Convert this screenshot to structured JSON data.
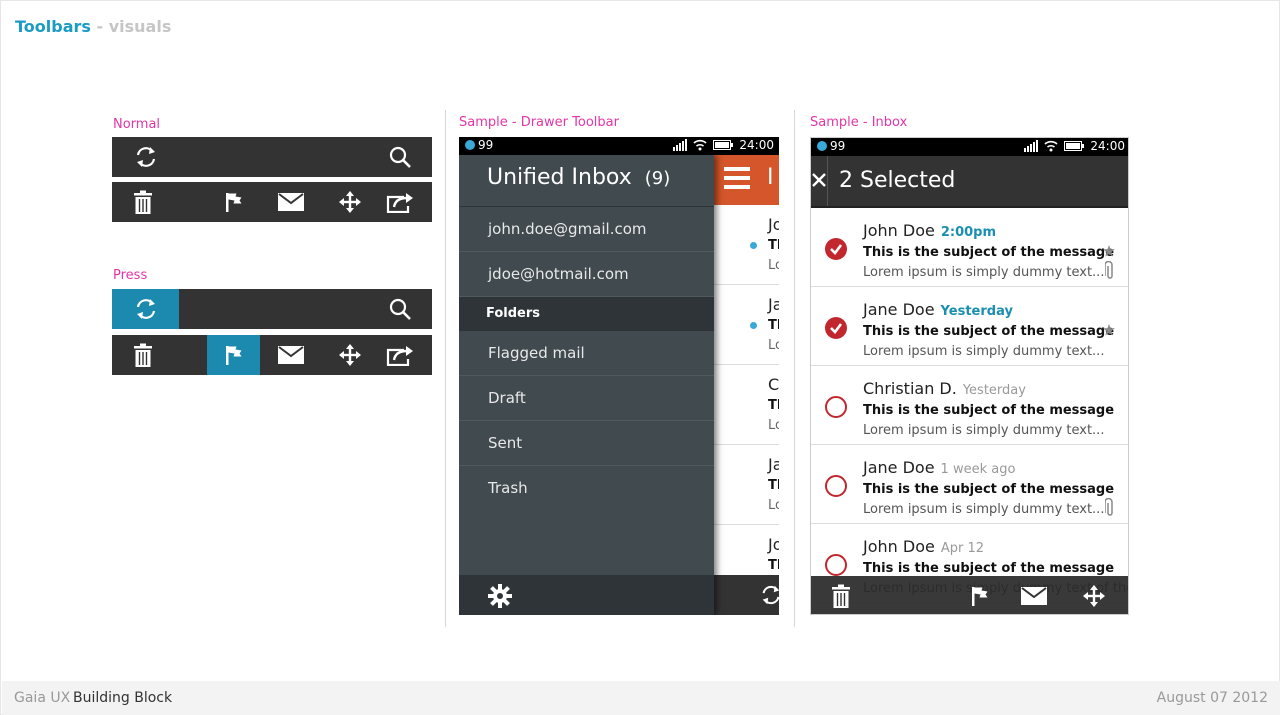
{
  "header": {
    "title": "Toolbars",
    "subtitle": "- visuals"
  },
  "sections": {
    "normal": "Normal",
    "press": "Press",
    "drawer": "Sample - Drawer Toolbar",
    "inbox": "Sample - Inbox"
  },
  "status_bar": {
    "notif_count": "99",
    "time": "24:00"
  },
  "drawer": {
    "title": "Unified Inbox",
    "count": "(9)",
    "accounts": [
      "john.doe@gmail.com",
      "jdoe@hotmail.com"
    ],
    "folders_label": "Folders",
    "folders": [
      "Flagged mail",
      "Draft",
      "Sent",
      "Trash"
    ],
    "peek_header_letter": "I",
    "peek_rows": [
      {
        "l1": "Jo",
        "l2": "Th",
        "l3": "Lo"
      },
      {
        "l1": "Ja",
        "l2": "Th",
        "l3": "Lo"
      },
      {
        "l1": "C",
        "l2": "Th",
        "l3": "Lo"
      },
      {
        "l1": "Ja",
        "l2": "Th",
        "l3": "Lo"
      },
      {
        "l1": "Jo",
        "l2": "Th",
        "l3": ""
      }
    ]
  },
  "inbox": {
    "header": "2 Selected",
    "messages": [
      {
        "name": "John Doe",
        "time": "2:00pm",
        "subject": "This is the subject of the message",
        "preview": "Lorem ipsum is simply dummy text...",
        "selected": true
      },
      {
        "name": "Jane Doe",
        "time": "Yesterday",
        "subject": "This is the subject of the message",
        "preview": "Lorem ipsum is simply dummy text...",
        "selected": true
      },
      {
        "name": "Christian D.",
        "time": "Yesterday",
        "subject": "This is the subject of the message",
        "preview": "Lorem ipsum is simply dummy text...",
        "selected": false
      },
      {
        "name": "Jane Doe",
        "time": "1 week ago",
        "subject": "This is the subject of the message",
        "preview": "Lorem ipsum is simply dummy text...",
        "selected": false
      },
      {
        "name": "John Doe",
        "time": "Apr 12",
        "subject": "This is the subject of the message",
        "preview": "Lorem ipsum is simply dummy text of the",
        "selected": false
      }
    ]
  },
  "footer": {
    "brand": "Gaia UX",
    "section": "Building Block",
    "date": "August 07 2012"
  },
  "colors": {
    "press_accent": "#1c8aae",
    "label_pink": "#e236a8",
    "title_blue": "#1a9cc4",
    "check_red": "#c1272d",
    "drawer_orange": "#d4562a"
  }
}
